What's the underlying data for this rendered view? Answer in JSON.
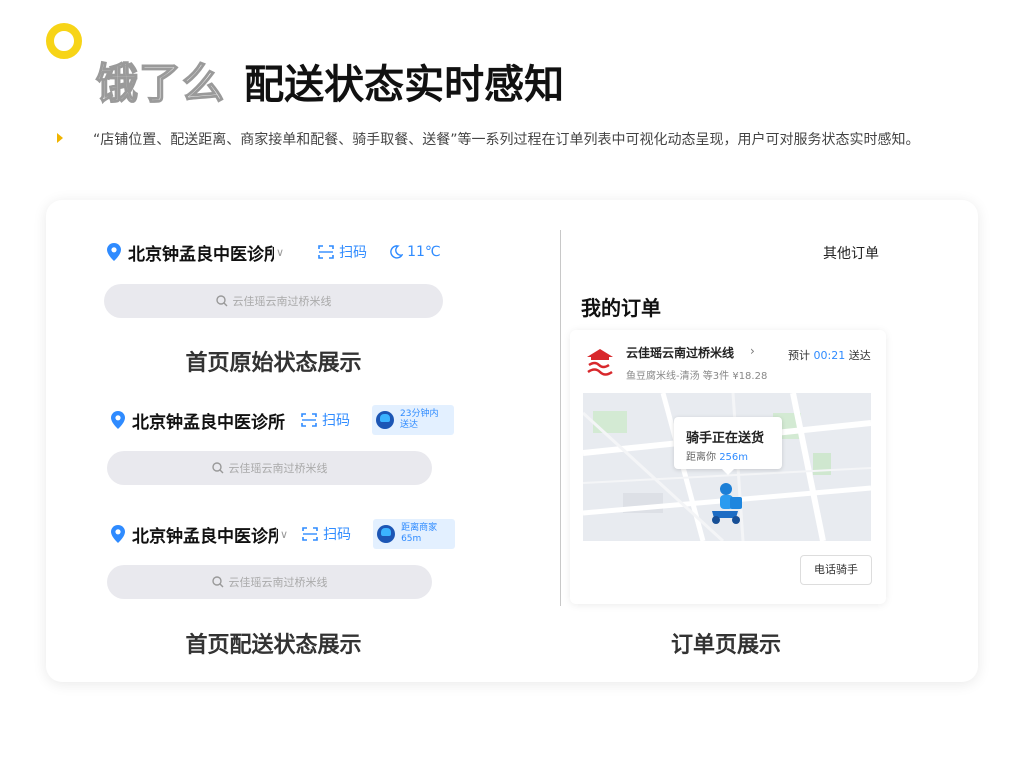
{
  "header": {
    "brand": "饿了么",
    "title": "配送状态实时感知"
  },
  "description": "“店铺位置、配送距离、商家接单和配餐、骑手取餐、送餐”等一系列过程在订单列表中可视化动态呈现，用户可对服务状态实时感知。",
  "home_original": {
    "location": "北京钟孟良中医诊所",
    "scan_label": "扫码",
    "weather": "11℃",
    "search_placeholder": "云佳瑶云南过桥米线",
    "caption": "首页原始状态展示"
  },
  "home_delivery": {
    "row1": {
      "location": "北京钟孟良中医诊所",
      "scan_label": "扫码",
      "badge": "23分钟内送达",
      "search_placeholder": "云佳瑶云南过桥米线"
    },
    "row2": {
      "location": "北京钟孟良中医诊所",
      "scan_label": "扫码",
      "badge": "距离商家65m",
      "search_placeholder": "云佳瑶云南过桥米线"
    },
    "caption": "首页配送状态展示"
  },
  "order_page": {
    "other_orders": "其他订单",
    "title": "我的订单",
    "shop_name": "云佳瑶云南过桥米线",
    "eta_prefix": "预计",
    "eta_time": "00:21",
    "eta_suffix": "送达",
    "items": "鱼豆腐米线-清汤 等3件 ¥18.28",
    "rider_status": "骑手正在送货",
    "distance_prefix": "距离你",
    "distance": "256m",
    "call_button": "电话骑手",
    "caption": "订单页展示"
  },
  "colors": {
    "accent_yellow": "#f7d417",
    "link_blue": "#2f8bff",
    "rider_dark": "#1c56b5"
  }
}
